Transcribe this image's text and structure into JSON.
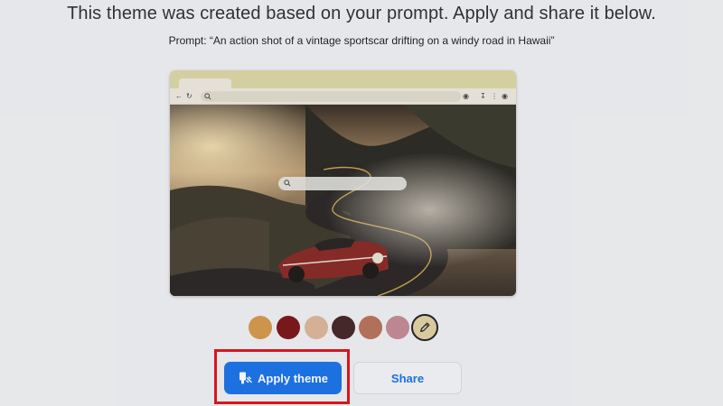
{
  "headline": "This theme was created based on your prompt. Apply and share it below.",
  "prompt_text": "Prompt: “An action shot of a vintage sportscar drifting on a windy road in Hawaii”",
  "preview": {
    "toolbar_icons": [
      "back-icon",
      "reload-icon",
      "search-icon",
      "extension-icon",
      "download-icon",
      "menu-icon"
    ]
  },
  "swatches": [
    {
      "name": "orange-tan",
      "color": "#d69a4c"
    },
    {
      "name": "dark-red",
      "color": "#7c1618"
    },
    {
      "name": "beige",
      "color": "#ddb79a"
    },
    {
      "name": "dark-brown",
      "color": "#452728"
    },
    {
      "name": "terracotta",
      "color": "#b8735a"
    },
    {
      "name": "dusty-rose",
      "color": "#c48c94"
    }
  ],
  "custom_swatch": {
    "icon": "pencil-icon"
  },
  "buttons": {
    "apply_label": "Apply theme",
    "share_label": "Share",
    "apply_color": "#1a73e8",
    "highlight_color": "#e0141b"
  }
}
